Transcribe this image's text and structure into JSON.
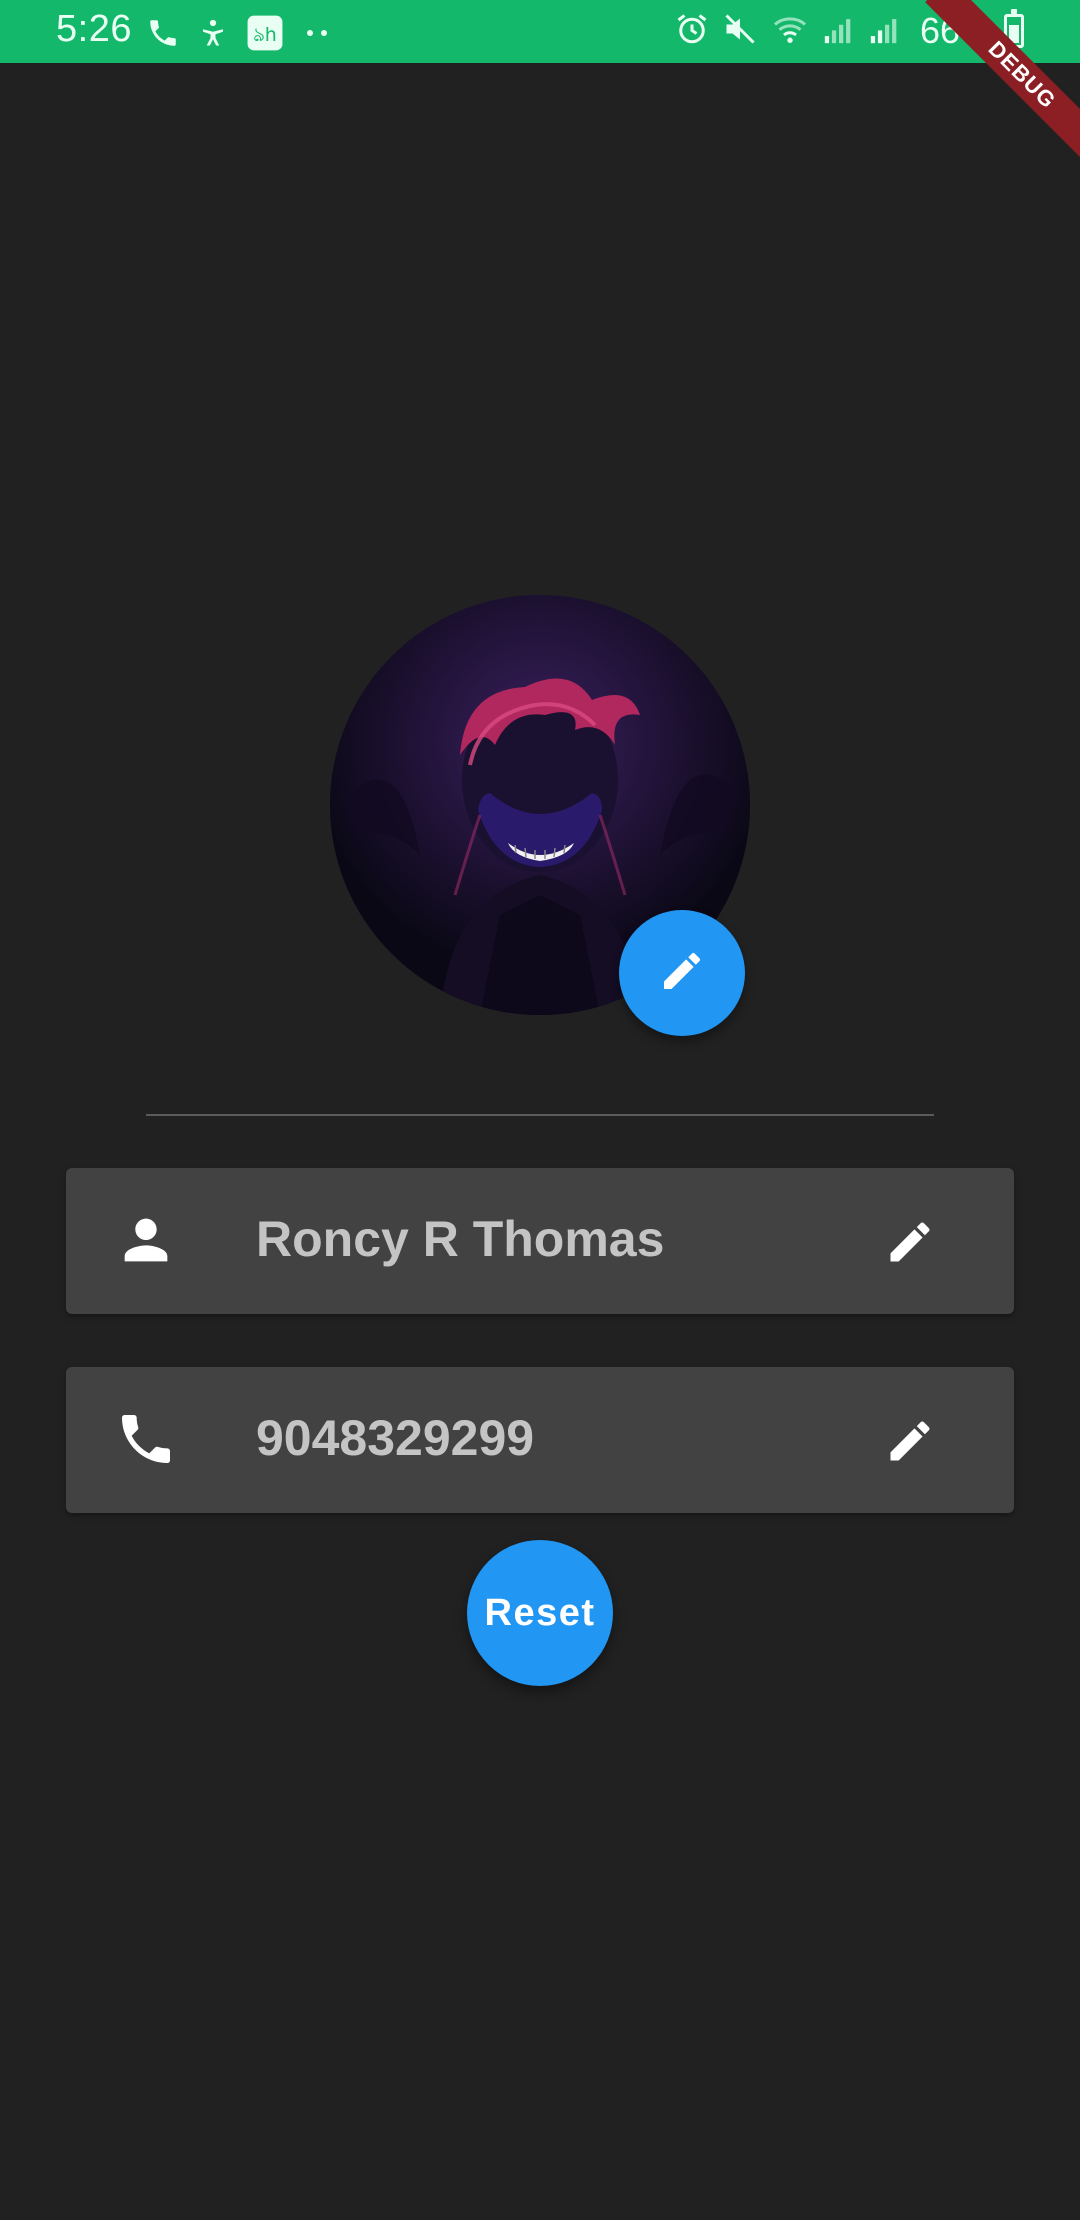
{
  "status_bar": {
    "time": "5:26",
    "battery": "66%",
    "left_icons": [
      "call-icon",
      "accessibility-icon",
      "app-icon",
      "more-dots-icon"
    ],
    "right_icons": [
      "alarm-icon",
      "mute-icon",
      "wifi-icon",
      "signal-icon",
      "signal-icon",
      "battery-icon"
    ],
    "battery_level": 0.66
  },
  "debug_banner": "DEBUG",
  "profile": {
    "avatar_icon": "avatar-image",
    "edit_avatar_icon": "edit-pencil-icon"
  },
  "fields": {
    "name": {
      "icon": "person-icon",
      "value": "Roncy R Thomas",
      "edit_icon": "edit-pencil-icon"
    },
    "phone": {
      "icon": "phone-icon",
      "value": "9048329299",
      "edit_icon": "edit-pencil-icon"
    }
  },
  "actions": {
    "reset_label": "Reset"
  },
  "colors": {
    "status_bar": "#14b86b",
    "background": "#212121",
    "card": "#424242",
    "accent": "#2196f3",
    "text": "#c4c4c4",
    "debug_ribbon": "#8b1f24"
  }
}
